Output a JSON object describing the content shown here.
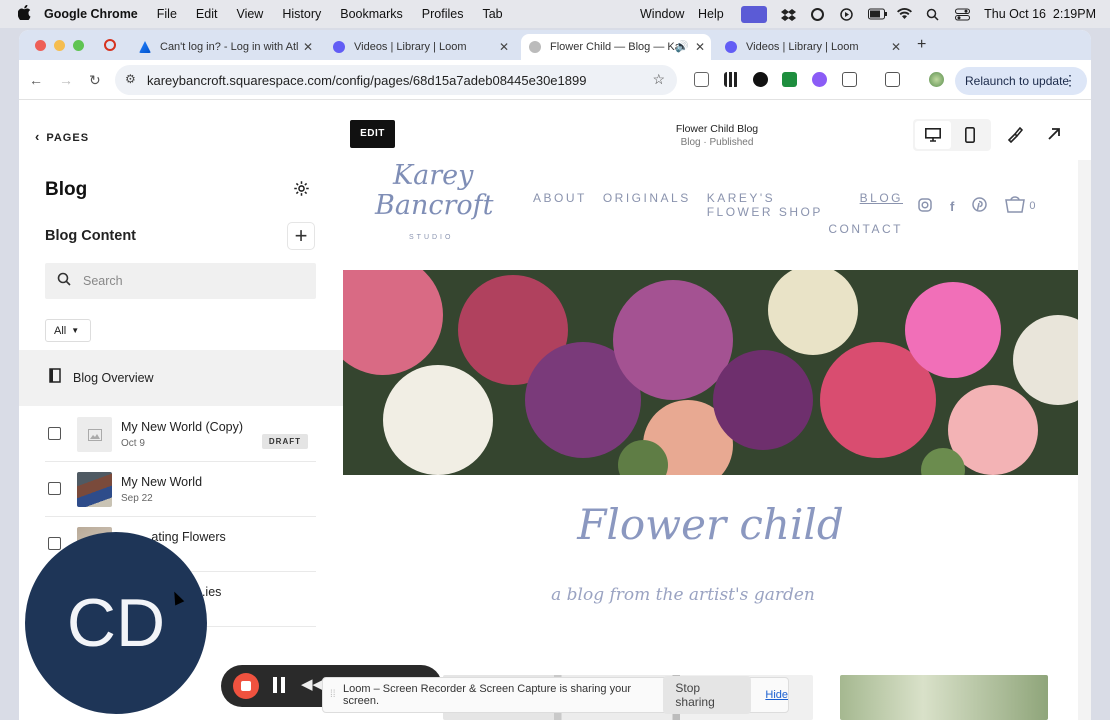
{
  "menubar": {
    "app": "Google Chrome",
    "items": [
      "File",
      "Edit",
      "View",
      "History",
      "Bookmarks",
      "Profiles",
      "Tab"
    ],
    "right_items": [
      "Window",
      "Help"
    ],
    "datetime": "Thu Oct 16  2:19PM"
  },
  "tabs": [
    {
      "title": "Can't log in? - Log in with Atl",
      "favicon_color": "#2684ff"
    },
    {
      "title": "Videos | Library | Loom",
      "favicon_color": "#625df5"
    },
    {
      "title": "Flower Child — Blog — Ka",
      "favicon_color": "#999999",
      "active": true
    },
    {
      "title": "Videos | Library | Loom",
      "favicon_color": "#625df5"
    }
  ],
  "toolbar": {
    "url": "kareybancroft.squarespace.com/config/pages/68d15a7adeb08445e30e1899",
    "relaunch_label": "Relaunch to update"
  },
  "sidebar": {
    "back_label": "PAGES",
    "title": "Blog",
    "content_title": "Blog Content",
    "search_placeholder": "Search",
    "filter_label": "All",
    "overview_label": "Blog Overview",
    "posts": [
      {
        "title": "My New World (Copy)",
        "date": "Oct 9",
        "badge": "DRAFT"
      },
      {
        "title": "My New World",
        "date": "Sep 22",
        "badge": ""
      },
      {
        "title": "...ating Flowers",
        "date": "",
        "badge": ""
      },
      {
        "title": "...ies",
        "date": "",
        "badge": ""
      }
    ]
  },
  "editor": {
    "edit_label": "EDIT",
    "page_name": "Flower Child Blog",
    "page_status": "Blog · Published"
  },
  "site": {
    "logo_line1": "Karey",
    "logo_line2": "Bancroft",
    "logo_sub": "STUDIO",
    "nav": [
      "ABOUT",
      "ORIGINALS",
      "KAREY'S FLOWER SHOP",
      "BLOG"
    ],
    "nav_row2": "CONTACT",
    "cart_count": "0",
    "blog_title": "Flower child",
    "tagline": "a blog from the artist's garden"
  },
  "overlay": {
    "avatar_initials": "CD",
    "share_message": "Loom – Screen Recorder & Screen Capture is sharing your screen.",
    "stop_label": "Stop sharing",
    "hide_label": "Hide"
  },
  "colors": {
    "accent": "#8b98c0",
    "avatar_bg": "#1e3557",
    "record": "#f0523f"
  }
}
